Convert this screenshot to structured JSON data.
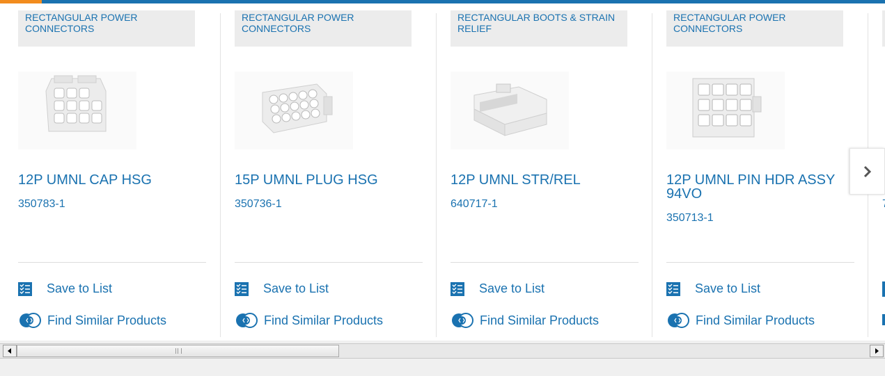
{
  "colors": {
    "accent_blue": "#1a72b0",
    "accent_orange": "#f28c1e",
    "category_bg": "#ececec"
  },
  "products": [
    {
      "category": "RECTANGULAR POWER CONNECTORS",
      "name": "12P UMNL CAP HSG",
      "part_number": "350783-1",
      "image_icon": "cap-housing-image"
    },
    {
      "category": "RECTANGULAR POWER CONNECTORS",
      "name": "15P UMNL PLUG HSG",
      "part_number": "350736-1",
      "image_icon": "plug-housing-image"
    },
    {
      "category": "RECTANGULAR BOOTS & STRAIN RELIEF",
      "name": "12P UMNL STR/REL",
      "part_number": "640717-1",
      "image_icon": "strain-relief-image"
    },
    {
      "category": "RECTANGULAR POWER CONNECTORS",
      "name": "12P UMNL PIN HDR ASSY 94VO",
      "part_number": "350713-1",
      "image_icon": "pin-header-image"
    },
    {
      "category": "",
      "name": "",
      "part_number": "7",
      "image_icon": ""
    }
  ],
  "actions": {
    "save_label": "Save to List",
    "similar_label": "Find Similar Products"
  },
  "carousel": {
    "next_icon": "chevron-right-icon"
  },
  "scrollbar": {
    "left_icon": "arrow-left-icon",
    "right_icon": "arrow-right-icon"
  }
}
